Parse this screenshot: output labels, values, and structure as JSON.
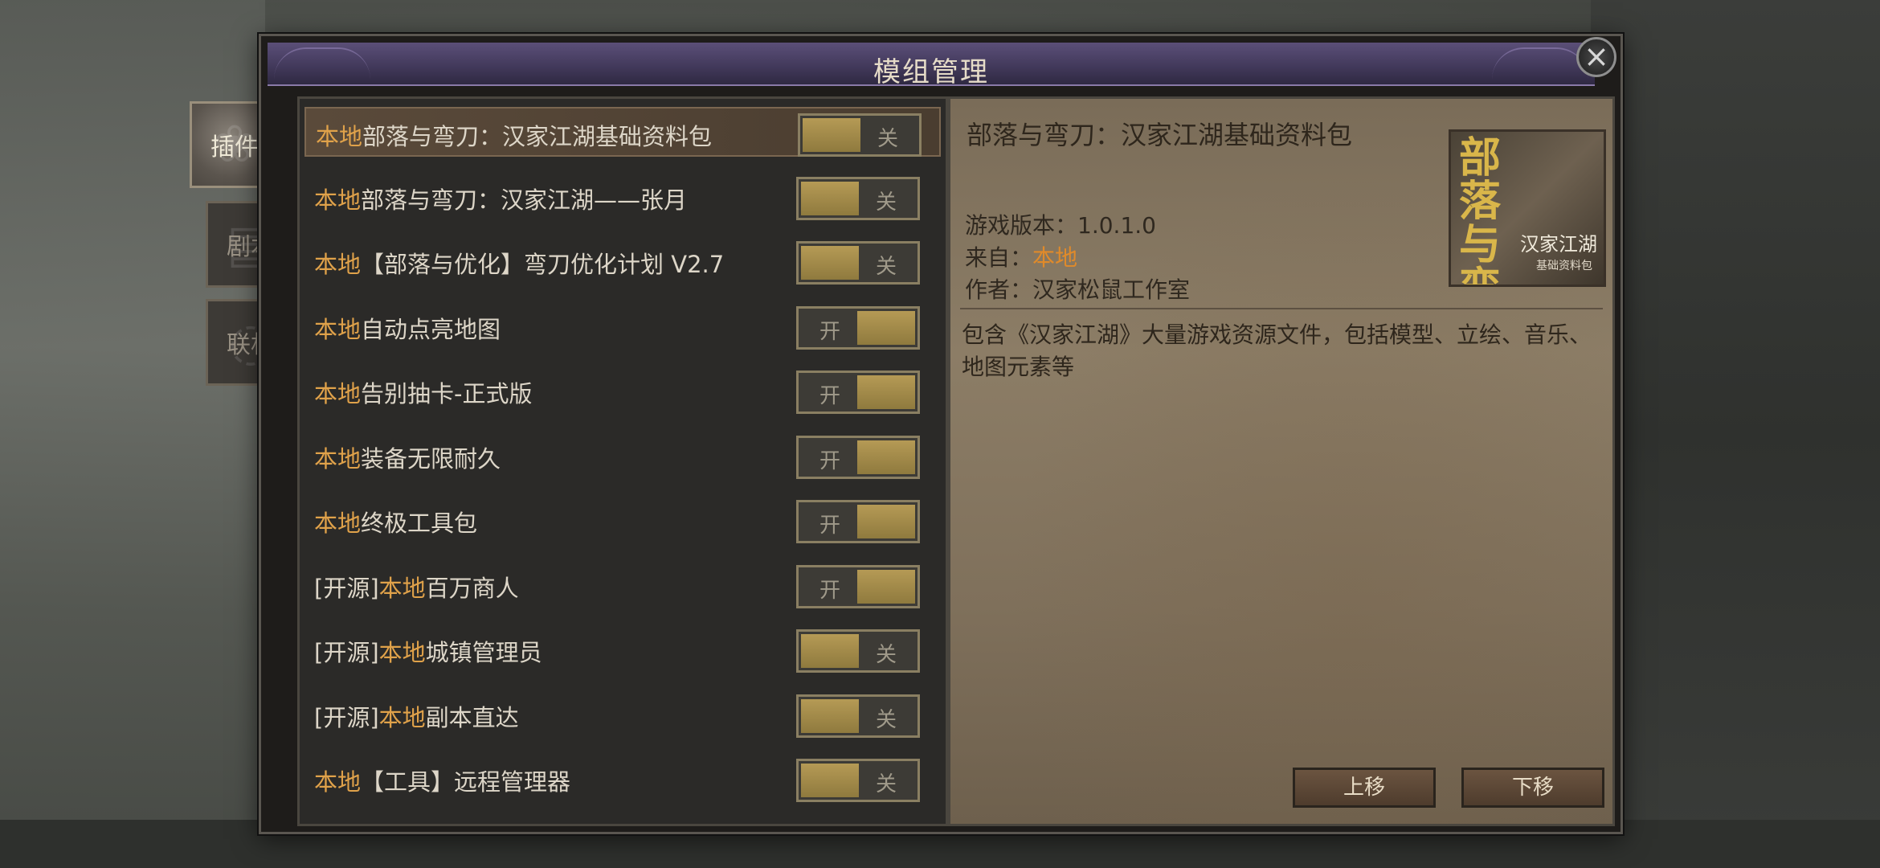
{
  "dialog": {
    "title": "模组管理",
    "close_icon": "close-icon"
  },
  "side_tabs": [
    {
      "label": "插件",
      "icon": "rose-icon",
      "active": true
    },
    {
      "label": "剧本",
      "icon": "scroll-icon",
      "active": false
    },
    {
      "label": "联机",
      "icon": "chat-bubble-icon",
      "active": false
    }
  ],
  "mods": [
    {
      "prefix": "",
      "local": "本地",
      "name": "部落与弯刀：汉家江湖基础资料包",
      "toggle": "关",
      "on": false,
      "selected": true
    },
    {
      "prefix": "",
      "local": "本地",
      "name": "部落与弯刀：汉家江湖——张月",
      "toggle": "关",
      "on": false
    },
    {
      "prefix": "",
      "local": "本地",
      "name": "【部落与优化】弯刀优化计划 V2.7",
      "toggle": "关",
      "on": false
    },
    {
      "prefix": "",
      "local": "本地",
      "name": "自动点亮地图",
      "toggle": "开",
      "on": true
    },
    {
      "prefix": "",
      "local": "本地",
      "name": "告别抽卡-正式版",
      "toggle": "开",
      "on": true
    },
    {
      "prefix": "",
      "local": "本地",
      "name": "装备无限耐久",
      "toggle": "开",
      "on": true
    },
    {
      "prefix": "",
      "local": "本地",
      "name": "终极工具包",
      "toggle": "开",
      "on": true
    },
    {
      "prefix": "[开源]",
      "local": "本地",
      "name": "百万商人",
      "toggle": "开",
      "on": true
    },
    {
      "prefix": "[开源]",
      "local": "本地",
      "name": "城镇管理员",
      "toggle": "关",
      "on": false
    },
    {
      "prefix": "[开源]",
      "local": "本地",
      "name": "副本直达",
      "toggle": "关",
      "on": false
    },
    {
      "prefix": "",
      "local": "本地",
      "name": "【工具】远程管理器",
      "toggle": "关",
      "on": false
    }
  ],
  "detail": {
    "title": "部落与弯刀：汉家江湖基础资料包",
    "version_label": "游戏版本：",
    "version": "1.0.1.0",
    "source_label": "来自：",
    "source": "本地",
    "author_label": "作者：",
    "author": "汉家松鼠工作室",
    "description": "包含《汉家江湖》大量游戏资源文件，包括模型、立绘、音乐、地图元素等",
    "thumbnail": {
      "title": "部落与弯刀",
      "subtitle": "汉家江湖",
      "caption": "基础资料包"
    },
    "move_up": "上移",
    "move_down": "下移"
  },
  "colors": {
    "accent_local": "#e0a24a",
    "title_bar": "#4a3f63",
    "toggle_knob": "#a8904c"
  }
}
